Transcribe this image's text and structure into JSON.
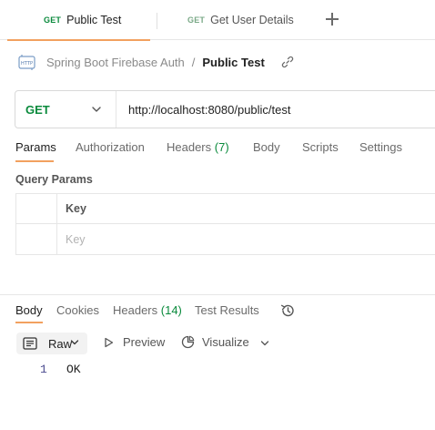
{
  "tabs": [
    {
      "method": "GET",
      "label": "Public Test",
      "active": true
    },
    {
      "method": "GET",
      "label": "Get User Details",
      "active": false
    }
  ],
  "icons": {
    "new_tab": "plus-icon",
    "request_type": "http-icon",
    "copy_link": "link-icon",
    "method_dropdown": "chevron-down-icon",
    "history": "history-icon",
    "format": "document-icon",
    "preview": "play-icon",
    "visualize": "visualize-icon"
  },
  "breadcrumb": {
    "collection": "Spring Boot Firebase Auth",
    "separator": "/",
    "request": "Public Test"
  },
  "request": {
    "method": "GET",
    "url": "http://localhost:8080/public/test"
  },
  "request_tabs": {
    "params": "Params",
    "authorization": "Authorization",
    "headers": "Headers",
    "headers_count": "(7)",
    "body": "Body",
    "scripts": "Scripts",
    "settings": "Settings",
    "active": "Params"
  },
  "query_params": {
    "title": "Query Params",
    "key_header": "Key",
    "key_placeholder": "Key"
  },
  "response_tabs": {
    "body": "Body",
    "cookies": "Cookies",
    "headers": "Headers",
    "headers_count": "(14)",
    "test_results": "Test Results",
    "active": "Body"
  },
  "response_toolbar": {
    "format": "Raw",
    "preview": "Preview",
    "visualize": "Visualize"
  },
  "response_body": {
    "line_number": "1",
    "text": "OK"
  },
  "colors": {
    "method_get": "#0a8a3c",
    "active_underline": "#f2a15f",
    "border": "#e6e6e6",
    "muted_text": "#6b6b6b"
  }
}
